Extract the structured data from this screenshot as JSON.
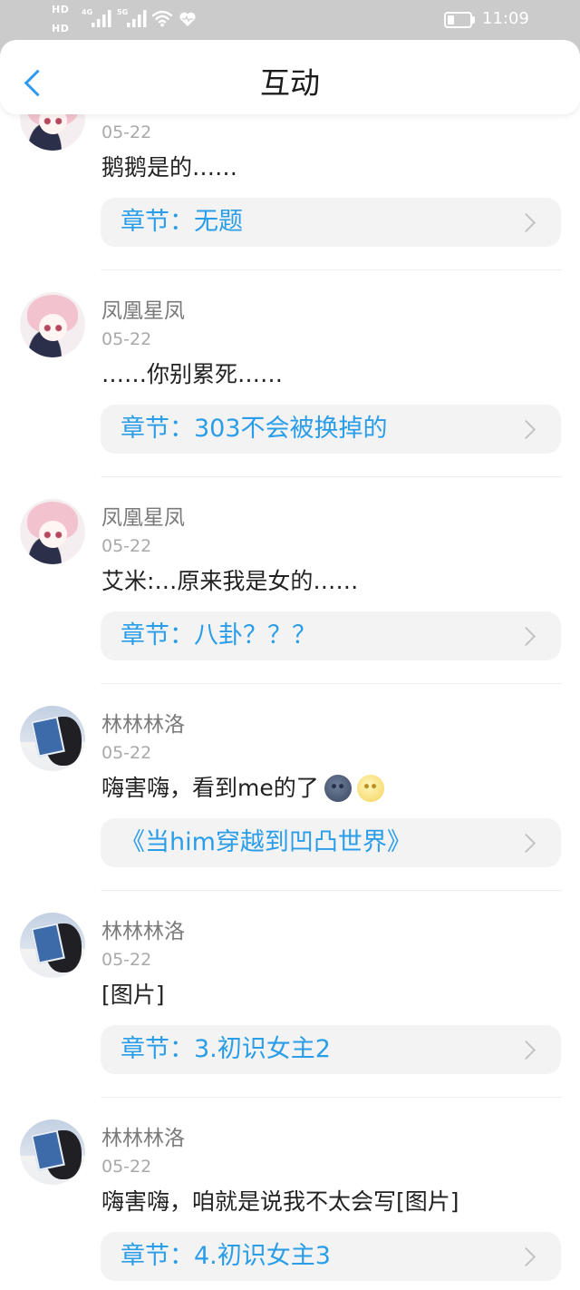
{
  "status_bar": {
    "hd_labels": [
      "HD",
      "HD"
    ],
    "sim1_network": "4G",
    "sim2_network": "5G",
    "time": "11:09",
    "battery_level": 0.3,
    "icons": {
      "signal": "signal-bars-icon",
      "wifi": "wifi-icon",
      "heart": "heart-icon",
      "battery": "battery-icon"
    }
  },
  "header": {
    "title": "互动",
    "back_icon": "chevron-left-icon"
  },
  "colors": {
    "accent": "#2a9de8",
    "back_chevron": "#2f9bef",
    "status_bar_bg": "#cbcbcb",
    "link_pill_bg": "#f3f3f3",
    "name_text": "#7a7a7a",
    "date_text": "#a9a9a9",
    "body_text": "#222222"
  },
  "comments": [
    {
      "date": "05-22",
      "text": "鹅鹅是的……",
      "link_label": "章节：无题"
    },
    {
      "name": "凤凰星凤",
      "date": "05-22",
      "text": "……你别累死……",
      "link_label": "章节：303不会被换掉的"
    },
    {
      "name": "凤凰星凤",
      "date": "05-22",
      "text": "艾米:…原来我是女的……",
      "link_label": "章节：八卦？？？"
    },
    {
      "name": "林林林洛",
      "date": "05-22",
      "text": "嗨害嗨，看到me的了",
      "emoji": [
        "new-moon-face-icon",
        "full-moon-face-icon"
      ],
      "link_label": "《当him穿越到凹凸世界》"
    },
    {
      "name": "林林林洛",
      "date": "05-22",
      "text": "[图片]",
      "link_label": "章节：3.初识女主2"
    },
    {
      "name": "林林林洛",
      "date": "05-22",
      "text": "嗨害嗨，咱就是说我不太会写[图片]",
      "link_label": "章节：4.初识女主3"
    }
  ]
}
